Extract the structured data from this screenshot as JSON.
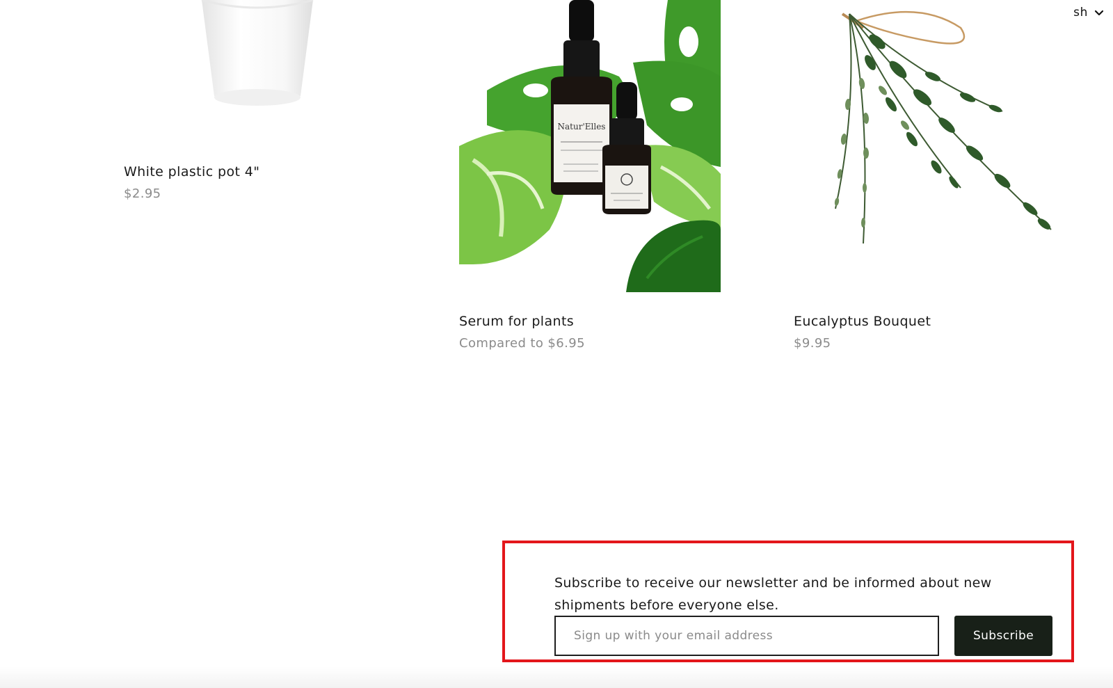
{
  "language": {
    "label": "English"
  },
  "products": [
    {
      "name": "White plastic pot 4\"",
      "price": "$2.95"
    },
    {
      "name": "Serum for plants",
      "price": "Compared to $6.95"
    },
    {
      "name": "Eucalyptus Bouquet",
      "price": "$9.95"
    }
  ],
  "newsletter": {
    "text": "Subscribe to receive our newsletter and be informed about new shipments before everyone else.",
    "email_placeholder": "Sign up with your email address",
    "button_label": "Subscribe"
  },
  "colors": {
    "highlight": "#e3161b",
    "button": "#182018",
    "price": "#8b8b8b"
  },
  "icons": [
    "uk-flag-icon",
    "chevron-down-icon"
  ]
}
